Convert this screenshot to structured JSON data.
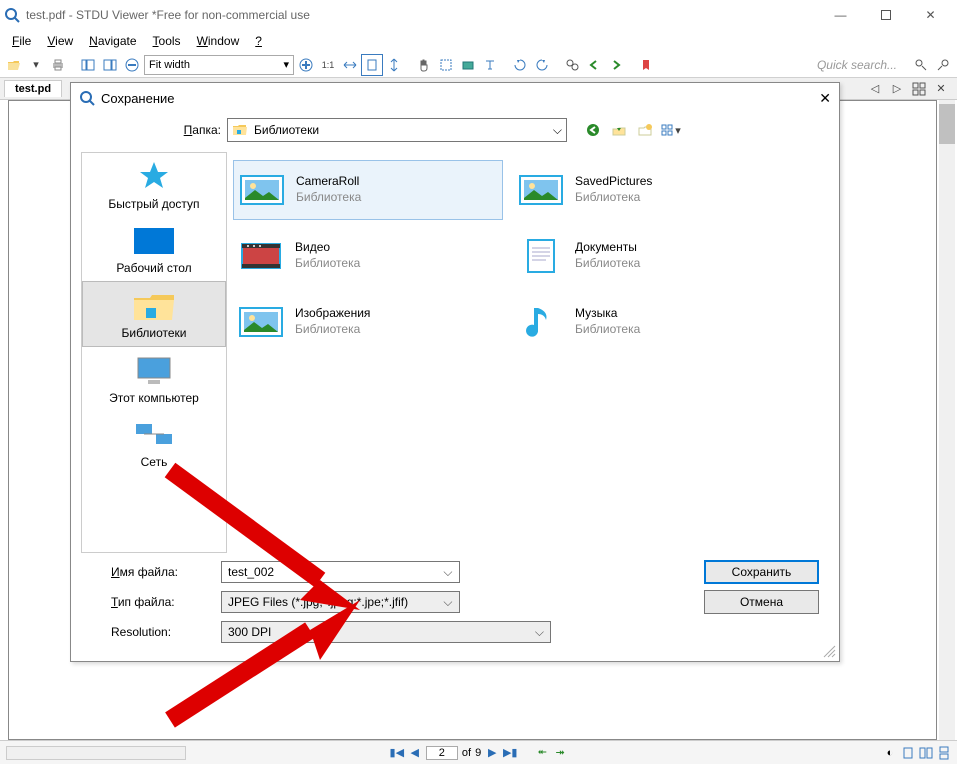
{
  "window": {
    "title": "test.pdf - STDU Viewer *Free for non-commercial use"
  },
  "menu": {
    "file": "File",
    "view": "View",
    "navigate": "Navigate",
    "tools": "Tools",
    "window": "Window",
    "help": "?"
  },
  "toolbar": {
    "zoom_mode": "Fit width",
    "mode_fit": "1:1",
    "quick_search_placeholder": "Quick search..."
  },
  "tabs": {
    "tab1": "test.pd"
  },
  "status": {
    "page_current": "2",
    "page_sep": "of",
    "page_total": "9"
  },
  "dialog": {
    "title": "Сохранение",
    "folder_label": "Папка:",
    "folder_value": "Библиотеки",
    "places": {
      "quick": "Быстрый доступ",
      "desktop": "Рабочий стол",
      "libs": "Библиотеки",
      "thispc": "Этот компьютер",
      "network": "Сеть"
    },
    "libs": [
      {
        "name": "CameraRoll",
        "sub": "Библиотека",
        "icon": "picture"
      },
      {
        "name": "SavedPictures",
        "sub": "Библиотека",
        "icon": "picture"
      },
      {
        "name": "Видео",
        "sub": "Библиотека",
        "icon": "video"
      },
      {
        "name": "Документы",
        "sub": "Библиотека",
        "icon": "doc"
      },
      {
        "name": "Изображения",
        "sub": "Библиотека",
        "icon": "picture"
      },
      {
        "name": "Музыка",
        "sub": "Библиотека",
        "icon": "music"
      }
    ],
    "form": {
      "name_label": "Имя файла:",
      "name_value": "test_002",
      "type_label": "Тип файла:",
      "type_value": "JPEG Files (*.jpg;*.jpeg;*.jpe;*.jfif)",
      "res_label": "Resolution:",
      "res_value": "300 DPI",
      "save": "Сохранить",
      "cancel": "Отмена"
    }
  }
}
